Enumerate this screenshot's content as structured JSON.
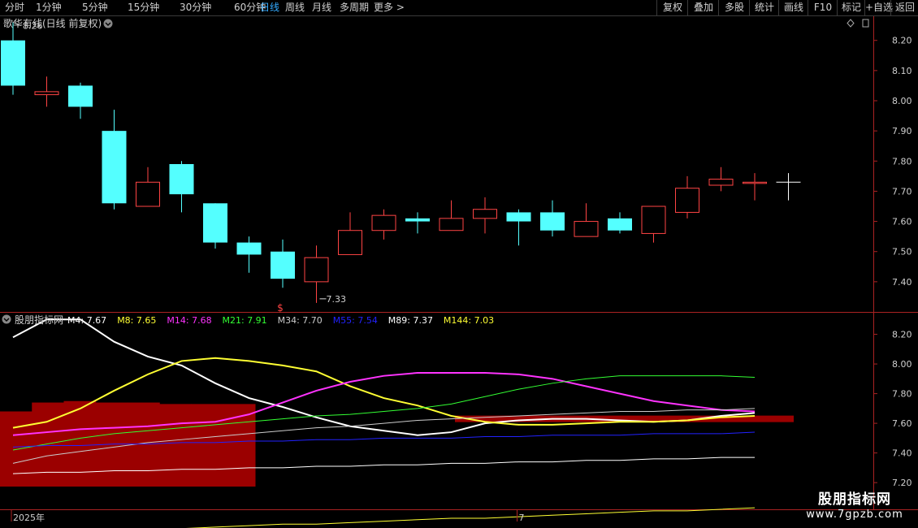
{
  "toolbar": {
    "periods": [
      {
        "label": "分时",
        "active": false
      },
      {
        "label": "1分钟",
        "active": false
      },
      {
        "label": "5分钟",
        "active": false
      },
      {
        "label": "15分钟",
        "active": false
      },
      {
        "label": "30分钟",
        "active": false
      },
      {
        "label": "60分钟",
        "active": false
      },
      {
        "label": "日线",
        "active": true
      },
      {
        "label": "周线",
        "active": false
      },
      {
        "label": "月线",
        "active": false
      },
      {
        "label": "多周期",
        "active": false
      },
      {
        "label": "更多",
        "active": false
      }
    ],
    "more_arrow": ">",
    "right_buttons": [
      "复权",
      "叠加",
      "多股",
      "统计",
      "画线",
      "F10",
      "标记",
      "+自选",
      "返回"
    ]
  },
  "colors": {
    "background": "#000000",
    "up": "#ff4444",
    "down": "#54ffff",
    "axis": "#aa2222",
    "label": "#d0d0d0",
    "fill": "#9b0000"
  },
  "price_panel": {
    "title": "歌华有线(日线 前复权)",
    "high_marker": "8.26",
    "low_marker": "7.33",
    "signal_glyph": "$"
  },
  "indicator_panel": {
    "title": "股朋指标网"
  },
  "date_axis": {
    "labels": [
      {
        "text": "2025年",
        "index": 0
      },
      {
        "text": "7",
        "index": 15
      }
    ]
  },
  "watermark": {
    "title": "股朋指标网",
    "url": "www.7gpzb.com"
  },
  "chart_data": [
    {
      "type": "candlestick",
      "y_ticks": [
        8.2,
        8.1,
        8.0,
        7.9,
        7.8,
        7.7,
        7.6,
        7.5,
        7.4
      ],
      "ylim": [
        7.3,
        8.28
      ],
      "candles": [
        {
          "o": 8.2,
          "h": 8.26,
          "l": 8.02,
          "c": 8.05
        },
        {
          "o": 8.02,
          "h": 8.08,
          "l": 7.98,
          "c": 8.03
        },
        {
          "o": 8.05,
          "h": 8.06,
          "l": 7.94,
          "c": 7.98
        },
        {
          "o": 7.9,
          "h": 7.97,
          "l": 7.64,
          "c": 7.66
        },
        {
          "o": 7.65,
          "h": 7.78,
          "l": 7.65,
          "c": 7.73
        },
        {
          "o": 7.79,
          "h": 7.8,
          "l": 7.63,
          "c": 7.69
        },
        {
          "o": 7.66,
          "h": 7.66,
          "l": 7.51,
          "c": 7.53
        },
        {
          "o": 7.53,
          "h": 7.55,
          "l": 7.43,
          "c": 7.49
        },
        {
          "o": 7.5,
          "h": 7.54,
          "l": 7.38,
          "c": 7.41
        },
        {
          "o": 7.4,
          "h": 7.52,
          "l": 7.33,
          "c": 7.48
        },
        {
          "o": 7.49,
          "h": 7.63,
          "l": 7.49,
          "c": 7.57
        },
        {
          "o": 7.57,
          "h": 7.64,
          "l": 7.54,
          "c": 7.62
        },
        {
          "o": 7.61,
          "h": 7.63,
          "l": 7.56,
          "c": 7.6
        },
        {
          "o": 7.57,
          "h": 7.67,
          "l": 7.57,
          "c": 7.61
        },
        {
          "o": 7.61,
          "h": 7.68,
          "l": 7.56,
          "c": 7.64
        },
        {
          "o": 7.63,
          "h": 7.64,
          "l": 7.52,
          "c": 7.6
        },
        {
          "o": 7.63,
          "h": 7.67,
          "l": 7.55,
          "c": 7.57
        },
        {
          "o": 7.55,
          "h": 7.66,
          "l": 7.55,
          "c": 7.6
        },
        {
          "o": 7.61,
          "h": 7.63,
          "l": 7.56,
          "c": 7.57
        },
        {
          "o": 7.56,
          "h": 7.65,
          "l": 7.53,
          "c": 7.65
        },
        {
          "o": 7.63,
          "h": 7.75,
          "l": 7.61,
          "c": 7.71
        },
        {
          "o": 7.72,
          "h": 7.78,
          "l": 7.7,
          "c": 7.74
        },
        {
          "o": 7.73,
          "h": 7.76,
          "l": 7.67,
          "c": 7.73
        }
      ]
    },
    {
      "type": "line",
      "y_ticks": [
        8.2,
        8.0,
        7.8,
        7.6,
        7.4,
        7.2
      ],
      "ylim": [
        7.02,
        8.34
      ],
      "band": {
        "values": [
          7.68,
          7.74,
          7.75,
          7.74,
          7.74,
          7.73,
          7.73,
          7.73
        ],
        "tail_value": 7.63
      },
      "series": [
        {
          "name": "M4",
          "value_text": "7.67",
          "color": "#ffffff",
          "width": 2,
          "values": [
            8.18,
            8.3,
            8.3,
            8.15,
            8.05,
            7.99,
            7.87,
            7.77,
            7.71,
            7.64,
            7.58,
            7.55,
            7.52,
            7.54,
            7.6,
            7.62,
            7.63,
            7.63,
            7.62,
            7.61,
            7.62,
            7.65,
            7.67
          ]
        },
        {
          "name": "M8",
          "value_text": "7.65",
          "color": "#ffff33",
          "width": 2,
          "values": [
            7.57,
            7.61,
            7.7,
            7.82,
            7.93,
            8.02,
            8.04,
            8.02,
            7.99,
            7.95,
            7.85,
            7.77,
            7.72,
            7.65,
            7.61,
            7.59,
            7.59,
            7.6,
            7.61,
            7.61,
            7.62,
            7.64,
            7.65
          ]
        },
        {
          "name": "M14",
          "value_text": "7.68",
          "color": "#ff33ff",
          "width": 2,
          "values": [
            7.52,
            7.54,
            7.56,
            7.57,
            7.58,
            7.6,
            7.61,
            7.66,
            7.74,
            7.82,
            7.88,
            7.92,
            7.94,
            7.94,
            7.94,
            7.93,
            7.9,
            7.85,
            7.8,
            7.75,
            7.72,
            7.69,
            7.68
          ]
        },
        {
          "name": "M21",
          "value_text": "7.91",
          "color": "#33ff33",
          "width": 1,
          "values": [
            7.42,
            7.46,
            7.5,
            7.53,
            7.55,
            7.57,
            7.59,
            7.61,
            7.63,
            7.65,
            7.66,
            7.68,
            7.7,
            7.73,
            7.78,
            7.83,
            7.87,
            7.9,
            7.92,
            7.92,
            7.92,
            7.92,
            7.91
          ]
        },
        {
          "name": "M34",
          "value_text": "7.70",
          "color": "#cccccc",
          "width": 1,
          "values": [
            7.33,
            7.38,
            7.41,
            7.44,
            7.47,
            7.49,
            7.51,
            7.53,
            7.55,
            7.57,
            7.58,
            7.6,
            7.62,
            7.63,
            7.64,
            7.65,
            7.66,
            7.67,
            7.68,
            7.68,
            7.69,
            7.69,
            7.7
          ]
        },
        {
          "name": "M55",
          "value_text": "7.54",
          "color": "#2222ff",
          "width": 1,
          "values": [
            7.44,
            7.45,
            7.45,
            7.46,
            7.46,
            7.47,
            7.47,
            7.48,
            7.48,
            7.49,
            7.49,
            7.5,
            7.5,
            7.5,
            7.51,
            7.51,
            7.52,
            7.52,
            7.52,
            7.53,
            7.53,
            7.53,
            7.54
          ]
        },
        {
          "name": "M89",
          "value_text": "7.37",
          "color": "#ffffff",
          "width": 1,
          "values": [
            7.26,
            7.27,
            7.27,
            7.28,
            7.28,
            7.29,
            7.29,
            7.3,
            7.3,
            7.31,
            7.31,
            7.32,
            7.32,
            7.33,
            7.33,
            7.34,
            7.34,
            7.35,
            7.35,
            7.36,
            7.36,
            7.37,
            7.37
          ]
        },
        {
          "name": "M144",
          "value_text": "7.03",
          "color": "#ffff33",
          "width": 1,
          "values": [
            6.84,
            6.85,
            6.86,
            6.87,
            6.88,
            6.89,
            6.9,
            6.91,
            6.92,
            6.92,
            6.93,
            6.94,
            6.95,
            6.96,
            6.96,
            6.97,
            6.98,
            6.99,
            7.0,
            7.01,
            7.01,
            7.02,
            7.03
          ]
        }
      ]
    }
  ]
}
